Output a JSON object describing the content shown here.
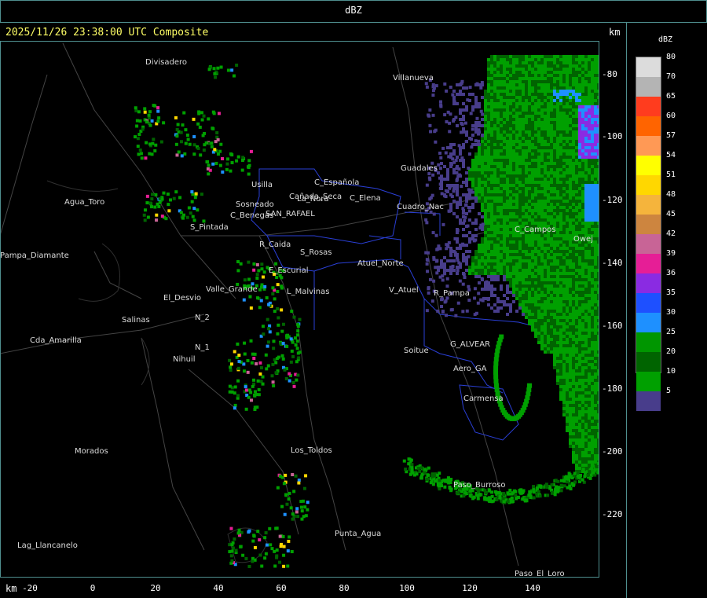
{
  "header": {
    "title": "dBZ"
  },
  "timestamp": "2025/11/26 23:38:00 UTC Composite",
  "axes": {
    "unit_top": "km",
    "unit_bottom": "km",
    "x_ticks": [
      "-20",
      "0",
      "20",
      "40",
      "60",
      "80",
      "100",
      "120",
      "140"
    ],
    "y_ticks": [
      "-80",
      "-100",
      "-120",
      "-140",
      "-160",
      "-180",
      "-200",
      "-220"
    ]
  },
  "legend": {
    "title": "dBZ",
    "items": [
      {
        "label": "80",
        "color": "#dcdcdc"
      },
      {
        "label": "70",
        "color": "#b4b4b4"
      },
      {
        "label": "65",
        "color": "#ff3c1e"
      },
      {
        "label": "60",
        "color": "#ff6400"
      },
      {
        "label": "57",
        "color": "#ff9955"
      },
      {
        "label": "54",
        "color": "#ffff00"
      },
      {
        "label": "51",
        "color": "#ffd700"
      },
      {
        "label": "48",
        "color": "#f5b43c"
      },
      {
        "label": "45",
        "color": "#cd853f"
      },
      {
        "label": "42",
        "color": "#c86496"
      },
      {
        "label": "39",
        "color": "#e61e96"
      },
      {
        "label": "36",
        "color": "#8a2be2"
      },
      {
        "label": "35",
        "color": "#1e50ff"
      },
      {
        "label": "30",
        "color": "#1e90ff"
      },
      {
        "label": "25",
        "color": "#009600"
      },
      {
        "label": "20",
        "color": "#006400"
      },
      {
        "label": "10",
        "color": "#00a000"
      },
      {
        "label": "5",
        "color": "#483d8b"
      }
    ]
  },
  "places": [
    {
      "name": "Divisadero"
    },
    {
      "name": "Villanueva"
    },
    {
      "name": "Agua_Toro"
    },
    {
      "name": "Usilla"
    },
    {
      "name": "La_Nora"
    },
    {
      "name": "C_Española"
    },
    {
      "name": "C_Elena"
    },
    {
      "name": "Guadales"
    },
    {
      "name": "Cuadro_Nac"
    },
    {
      "name": "SAN_RAFAEL"
    },
    {
      "name": "C_Benegas"
    },
    {
      "name": "S_Pintada"
    },
    {
      "name": "R_Caida"
    },
    {
      "name": "S_Rosas"
    },
    {
      "name": "Atuel_Norte"
    },
    {
      "name": "E_Escurial"
    },
    {
      "name": "L_Malvinas"
    },
    {
      "name": "Valle_Grande"
    },
    {
      "name": "El_Desvio"
    },
    {
      "name": "Salinas"
    },
    {
      "name": "Pampa_Diamante"
    },
    {
      "name": "Cda_Amarilla"
    },
    {
      "name": "N_2"
    },
    {
      "name": "N_1"
    },
    {
      "name": "Nihuil"
    },
    {
      "name": "V_Atuel"
    },
    {
      "name": "R_Pampa"
    },
    {
      "name": "Soitue"
    },
    {
      "name": "G_ALVEAR"
    },
    {
      "name": "Aero_GA"
    },
    {
      "name": "Carmensa"
    },
    {
      "name": "Paso_Burroso"
    },
    {
      "name": "Los_Toldos"
    },
    {
      "name": "Morados"
    },
    {
      "name": "Punta_Agua"
    },
    {
      "name": "Lag_Llancanelo"
    },
    {
      "name": "Paso_El_Loro"
    },
    {
      "name": "C_Campos"
    },
    {
      "name": "Owej"
    },
    {
      "name": "Cañada_Seca"
    },
    {
      "name": "Sosneado"
    }
  ]
}
